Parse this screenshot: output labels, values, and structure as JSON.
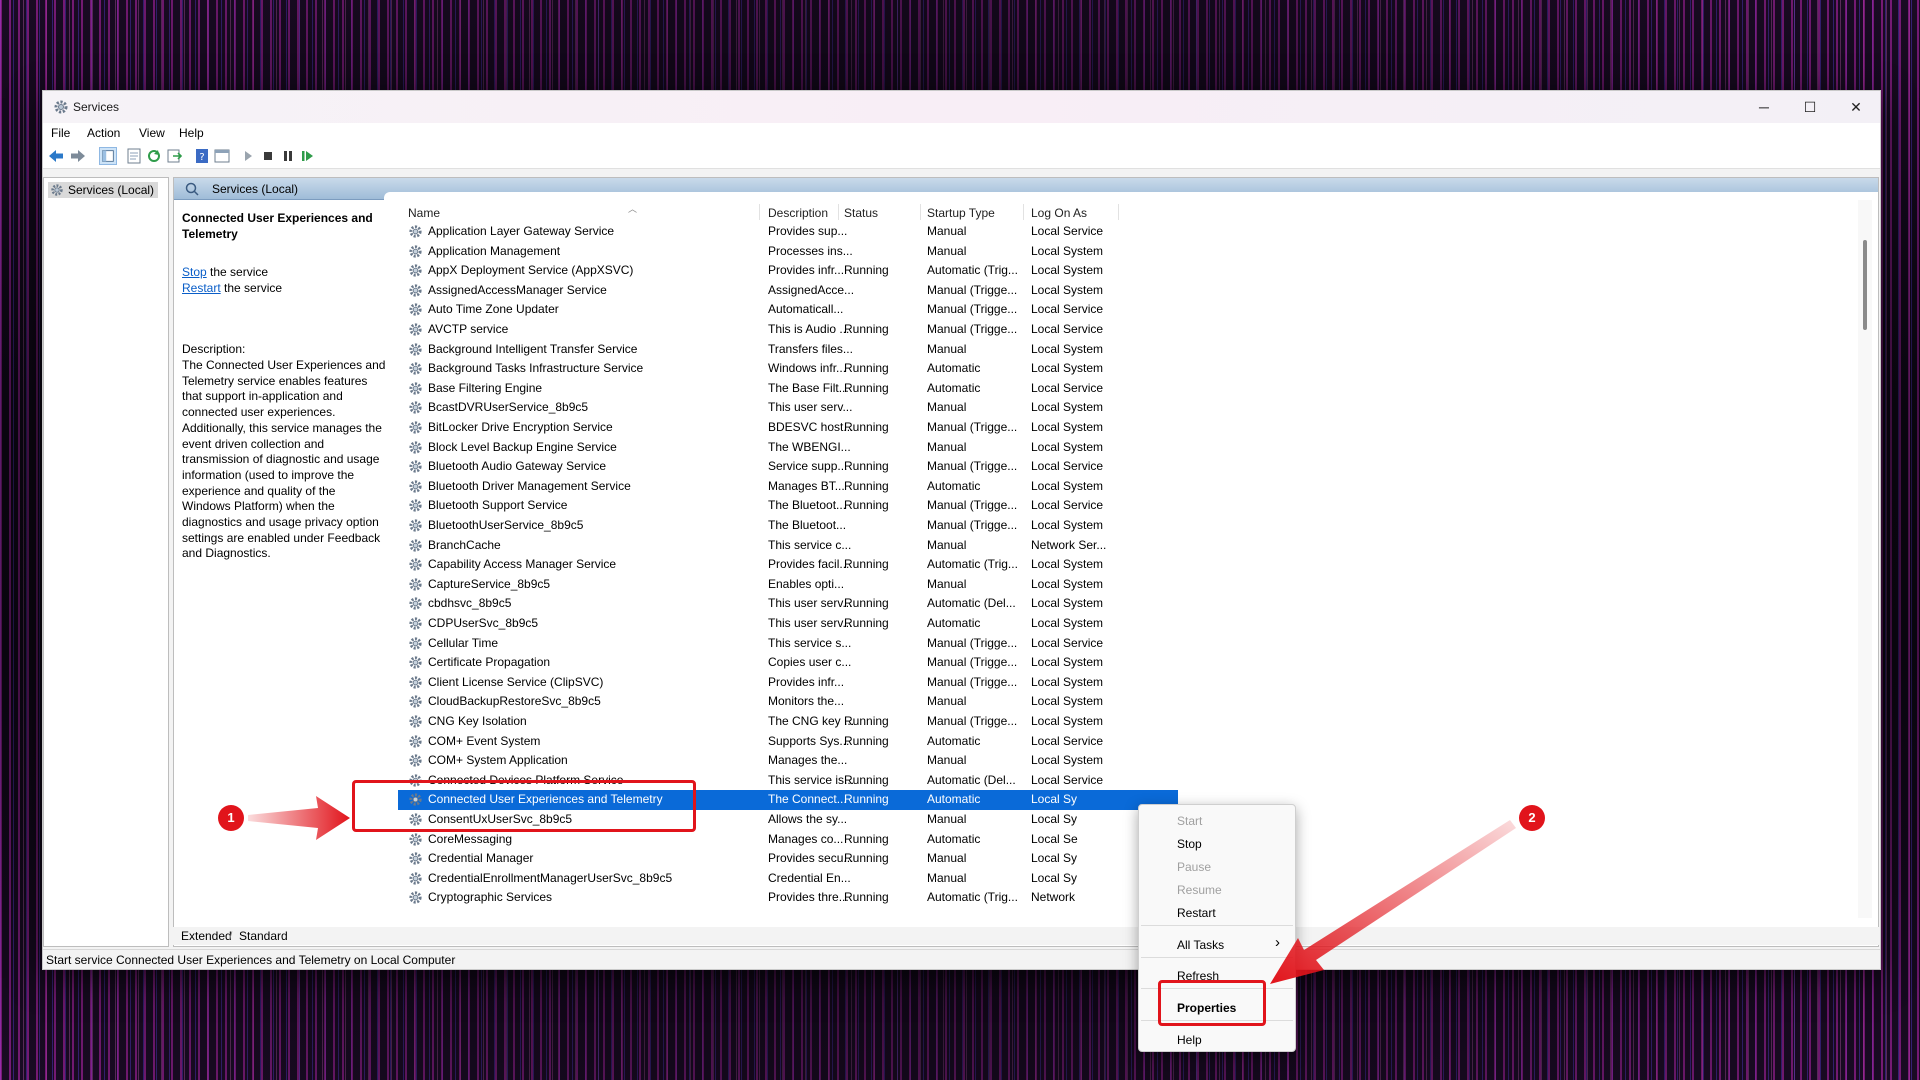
{
  "window": {
    "title": "Services",
    "controls": {
      "minimize": "─",
      "maximize": "☐",
      "close": "✕"
    }
  },
  "menu": [
    "File",
    "Action",
    "View",
    "Help"
  ],
  "tree": {
    "node": "Services (Local)"
  },
  "pane_header": "Services (Local)",
  "extended": {
    "service_name": "Connected User Experiences and Telemetry",
    "stop_link": "Stop",
    "stop_suffix": " the service",
    "restart_link": "Restart",
    "restart_suffix": " the service",
    "description_label": "Description:",
    "description": "The Connected User Experiences and Telemetry service enables features that support in-application and connected user experiences. Additionally, this service manages the event driven collection and transmission of diagnostic and usage information (used to improve the experience and quality of the Windows Platform) when the diagnostics and usage privacy option settings are enabled under Feedback and Diagnostics."
  },
  "columns": [
    "Name",
    "Description",
    "Status",
    "Startup Type",
    "Log On As"
  ],
  "services": [
    [
      "Application Layer Gateway Service",
      "Provides sup...",
      "",
      "Manual",
      "Local Service"
    ],
    [
      "Application Management",
      "Processes ins...",
      "",
      "Manual",
      "Local System"
    ],
    [
      "AppX Deployment Service (AppXSVC)",
      "Provides infr...",
      "Running",
      "Automatic (Trig...",
      "Local System"
    ],
    [
      "AssignedAccessManager Service",
      "AssignedAcce...",
      "",
      "Manual (Trigge...",
      "Local System"
    ],
    [
      "Auto Time Zone Updater",
      "Automaticall...",
      "",
      "Manual (Trigge...",
      "Local Service"
    ],
    [
      "AVCTP service",
      "This is Audio ...",
      "Running",
      "Manual (Trigge...",
      "Local Service"
    ],
    [
      "Background Intelligent Transfer Service",
      "Transfers files...",
      "",
      "Manual",
      "Local System"
    ],
    [
      "Background Tasks Infrastructure Service",
      "Windows infr...",
      "Running",
      "Automatic",
      "Local System"
    ],
    [
      "Base Filtering Engine",
      "The Base Filt...",
      "Running",
      "Automatic",
      "Local Service"
    ],
    [
      "BcastDVRUserService_8b9c5",
      "This user serv...",
      "",
      "Manual",
      "Local System"
    ],
    [
      "BitLocker Drive Encryption Service",
      "BDESVC host...",
      "Running",
      "Manual (Trigge...",
      "Local System"
    ],
    [
      "Block Level Backup Engine Service",
      "The WBENGI...",
      "",
      "Manual",
      "Local System"
    ],
    [
      "Bluetooth Audio Gateway Service",
      "Service supp...",
      "Running",
      "Manual (Trigge...",
      "Local Service"
    ],
    [
      "Bluetooth Driver Management Service",
      "Manages BT...",
      "Running",
      "Automatic",
      "Local System"
    ],
    [
      "Bluetooth Support Service",
      "The Bluetoot...",
      "Running",
      "Manual (Trigge...",
      "Local Service"
    ],
    [
      "BluetoothUserService_8b9c5",
      "The Bluetoot...",
      "",
      "Manual (Trigge...",
      "Local System"
    ],
    [
      "BranchCache",
      "This service c...",
      "",
      "Manual",
      "Network Ser..."
    ],
    [
      "Capability Access Manager Service",
      "Provides facil...",
      "Running",
      "Automatic (Trig...",
      "Local System"
    ],
    [
      "CaptureService_8b9c5",
      "Enables opti...",
      "",
      "Manual",
      "Local System"
    ],
    [
      "cbdhsvc_8b9c5",
      "This user serv...",
      "Running",
      "Automatic (Del...",
      "Local System"
    ],
    [
      "CDPUserSvc_8b9c5",
      "This user serv...",
      "Running",
      "Automatic",
      "Local System"
    ],
    [
      "Cellular Time",
      "This service s...",
      "",
      "Manual (Trigge...",
      "Local Service"
    ],
    [
      "Certificate Propagation",
      "Copies user c...",
      "",
      "Manual (Trigge...",
      "Local System"
    ],
    [
      "Client License Service (ClipSVC)",
      "Provides infr...",
      "",
      "Manual (Trigge...",
      "Local System"
    ],
    [
      "CloudBackupRestoreSvc_8b9c5",
      "Monitors the...",
      "",
      "Manual",
      "Local System"
    ],
    [
      "CNG Key Isolation",
      "The CNG key ...",
      "Running",
      "Manual (Trigge...",
      "Local System"
    ],
    [
      "COM+ Event System",
      "Supports Sys...",
      "Running",
      "Automatic",
      "Local Service"
    ],
    [
      "COM+ System Application",
      "Manages the...",
      "",
      "Manual",
      "Local System"
    ],
    [
      "Connected Devices Platform Service",
      "This service is...",
      "Running",
      "Automatic (Del...",
      "Local Service"
    ],
    [
      "Connected User Experiences and Telemetry",
      "The Connect...",
      "Running",
      "Automatic",
      "Local Sy"
    ],
    [
      "ConsentUxUserSvc_8b9c5",
      "Allows the sy...",
      "",
      "Manual",
      "Local Sy"
    ],
    [
      "CoreMessaging",
      "Manages co...",
      "Running",
      "Automatic",
      "Local Se"
    ],
    [
      "Credential Manager",
      "Provides secu...",
      "Running",
      "Manual",
      "Local Sy"
    ],
    [
      "CredentialEnrollmentManagerUserSvc_8b9c5",
      "Credential En...",
      "",
      "Manual",
      "Local Sy"
    ],
    [
      "Cryptographic Services",
      "Provides thre...",
      "Running",
      "Automatic (Trig...",
      "Network"
    ]
  ],
  "selected_index": 29,
  "tabs": [
    "Extended",
    "Standard"
  ],
  "status_text": "Start service Connected User Experiences and Telemetry on Local Computer",
  "context_menu": {
    "start": "Start",
    "stop": "Stop",
    "pause": "Pause",
    "resume": "Resume",
    "restart": "Restart",
    "all_tasks": "All Tasks",
    "all_tasks_arrow": "›",
    "refresh": "Refresh",
    "properties": "Properties",
    "help": "Help"
  },
  "annotations": {
    "badge1": "1",
    "badge2": "2"
  },
  "colors": {
    "selection": "#0a6ad8",
    "highlight": "#e1141b",
    "link": "#0a5ec8"
  }
}
